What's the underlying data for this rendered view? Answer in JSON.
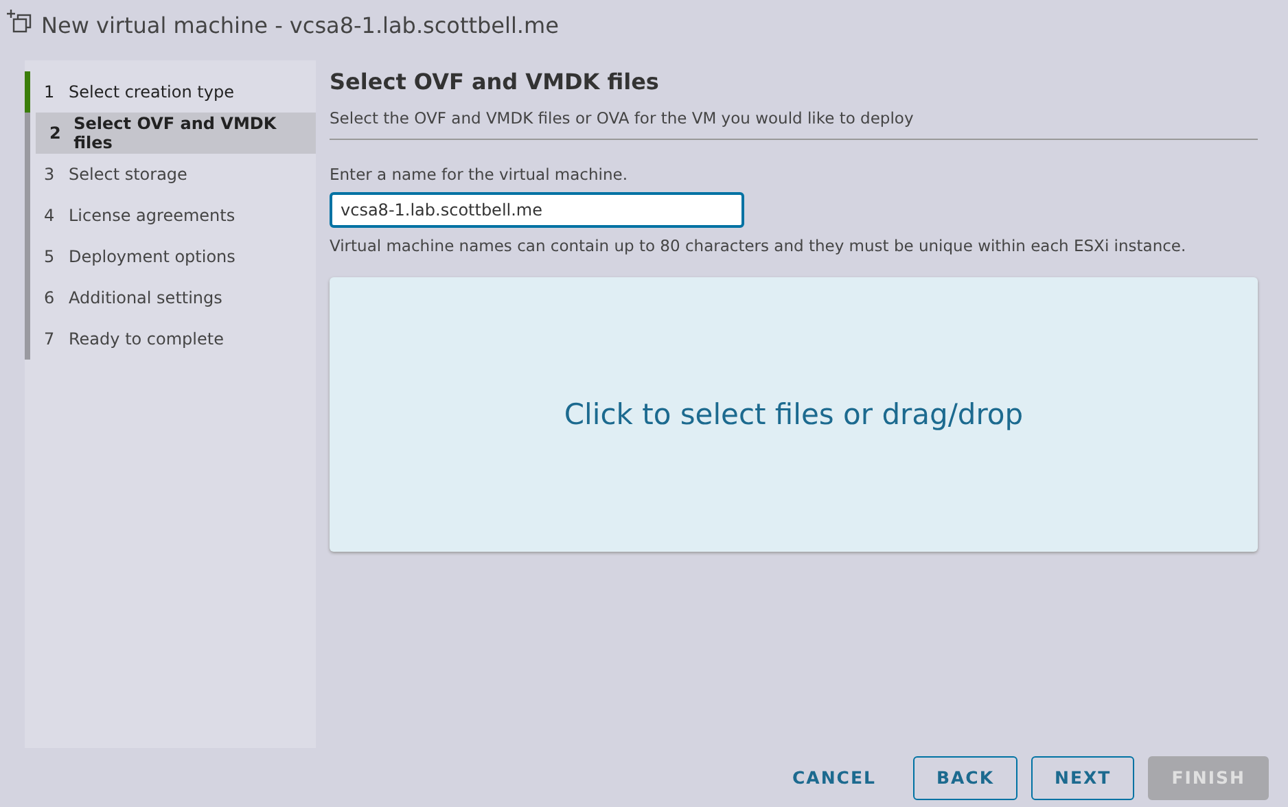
{
  "window": {
    "title": "New virtual machine - vcsa8-1.lab.scottbell.me"
  },
  "steps": [
    {
      "number": "1",
      "label": "Select creation type",
      "completed": true,
      "selected": false
    },
    {
      "number": "2",
      "label": "Select OVF and VMDK files",
      "completed": false,
      "selected": true
    },
    {
      "number": "3",
      "label": "Select storage",
      "completed": false,
      "selected": false
    },
    {
      "number": "4",
      "label": "License agreements",
      "completed": false,
      "selected": false
    },
    {
      "number": "5",
      "label": "Deployment options",
      "completed": false,
      "selected": false
    },
    {
      "number": "6",
      "label": "Additional settings",
      "completed": false,
      "selected": false
    },
    {
      "number": "7",
      "label": "Ready to complete",
      "completed": false,
      "selected": false
    }
  ],
  "page": {
    "heading": "Select OVF and VMDK files",
    "subheading": "Select the OVF and VMDK files or OVA for the VM you would like to deploy",
    "name_label": "Enter a name for the virtual machine.",
    "name_value": "vcsa8-1.lab.scottbell.me",
    "name_hint": "Virtual machine names can contain up to 80 characters and they must be unique within each ESXi instance.",
    "dropzone": "Click to select files or drag/drop"
  },
  "buttons": [
    {
      "label": "CANCEL",
      "kind": "flat",
      "disabled": false
    },
    {
      "label": "BACK",
      "kind": "outline",
      "disabled": false
    },
    {
      "label": "NEXT",
      "kind": "outline",
      "disabled": false
    },
    {
      "label": "FINISH",
      "kind": "solid",
      "disabled": true
    }
  ]
}
